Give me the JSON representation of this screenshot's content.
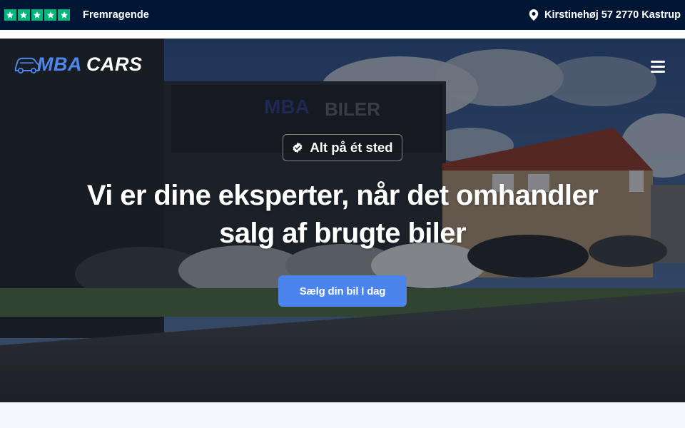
{
  "topbar": {
    "rating_label": "Fremragende",
    "rating_stars": 5,
    "address": "Kirstinehøj 57 2770 Kastrup",
    "icons": {
      "stars": "trustpilot-star-icon",
      "location": "map-pin-icon"
    },
    "colors": {
      "background": "#011635",
      "star_box": "#00b67a"
    }
  },
  "header": {
    "logo_primary": "MBA",
    "logo_secondary": "CARS",
    "menu_icon": "hamburger-menu-icon",
    "colors": {
      "logo_primary": "#4f86ec",
      "logo_secondary": "#ffffff"
    }
  },
  "hero": {
    "badge_text": "Alt på ét sted",
    "badge_icon": "check-badge-icon",
    "headline_line1": "Vi er dine eksperter, når det omhandler",
    "headline_line2": "salg af brugte biler",
    "cta_label": "Sælg din bil I dag",
    "building_sign": "MBA BILER",
    "colors": {
      "cta": "#4a84ec"
    }
  }
}
